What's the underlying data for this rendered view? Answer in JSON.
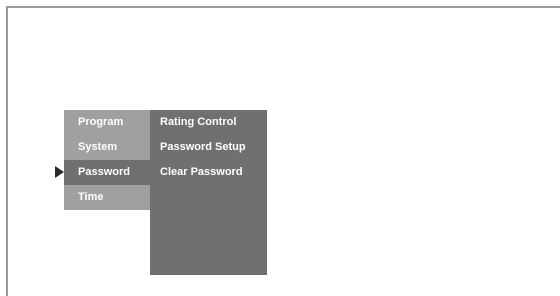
{
  "menu": {
    "items": [
      {
        "label": "Program"
      },
      {
        "label": "System"
      },
      {
        "label": "Password"
      },
      {
        "label": "Time"
      }
    ],
    "selected_index": 2
  },
  "submenu": {
    "options": [
      {
        "label": "Rating Control"
      },
      {
        "label": "Password Setup"
      },
      {
        "label": "Clear Password"
      }
    ]
  },
  "colors": {
    "menu_bg": "#a0a0a0",
    "menu_selected_bg": "#6f6f6f",
    "panel_bg": "#707070",
    "text": "#ffffff",
    "pointer": "#2b2b2b"
  }
}
